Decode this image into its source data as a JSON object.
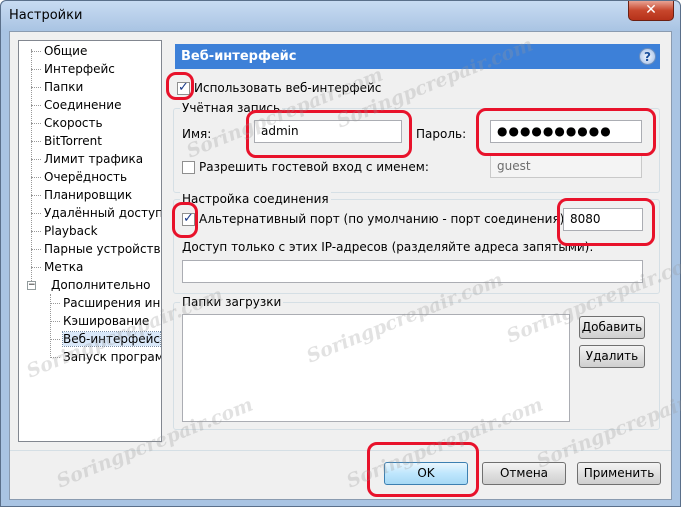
{
  "window": {
    "title": "Настройки",
    "close_label": "✕"
  },
  "tree": {
    "items": [
      {
        "label": "Общие"
      },
      {
        "label": "Интерфейс"
      },
      {
        "label": "Папки"
      },
      {
        "label": "Соединение"
      },
      {
        "label": "Скорость"
      },
      {
        "label": "BitTorrent"
      },
      {
        "label": "Лимит трафика"
      },
      {
        "label": "Очерёдность"
      },
      {
        "label": "Планировщик"
      },
      {
        "label": "Удалённый доступ"
      },
      {
        "label": "Playback"
      },
      {
        "label": "Парные устройства"
      },
      {
        "label": "Метка"
      },
      {
        "label": "Дополнительно",
        "expander": "−"
      },
      {
        "label": "Расширения ин"
      },
      {
        "label": "Кэширование"
      },
      {
        "label": "Веб-интерфейс",
        "selected": true
      },
      {
        "label": "Запуск програм"
      }
    ]
  },
  "panel": {
    "title": "Веб-интерфейс",
    "help_label": "?"
  },
  "webui": {
    "enable_label": "Использовать веб-интерфейс",
    "enable_checked": true,
    "account_group": "Учётная запись",
    "username_label": "Имя:",
    "username_value": "admin",
    "password_label": "Пароль:",
    "password_value": "●●●●●●●●●●",
    "guest_label": "Разрешить гостевой вход с именем:",
    "guest_checked": false,
    "guest_value": "guest"
  },
  "connection": {
    "group": "Настройка соединения",
    "alt_port_label": "Альтернативный порт (по умолчанию - порт соединения):",
    "alt_port_checked": true,
    "alt_port_value": "8080",
    "ip_label": "Доступ только с этих IP-адресов (разделяйте адреса запятыми):",
    "ip_value": ""
  },
  "downloads": {
    "group": "Папки загрузки",
    "add_label": "Добавить",
    "remove_label": "Удалить"
  },
  "footer": {
    "ok_label": "OK",
    "cancel_label": "Отмена",
    "apply_label": "Применить"
  },
  "watermark": "Soringpcrepair.com",
  "colors": {
    "header_bg": "#3d80d8",
    "highlight": "#e8122b"
  }
}
